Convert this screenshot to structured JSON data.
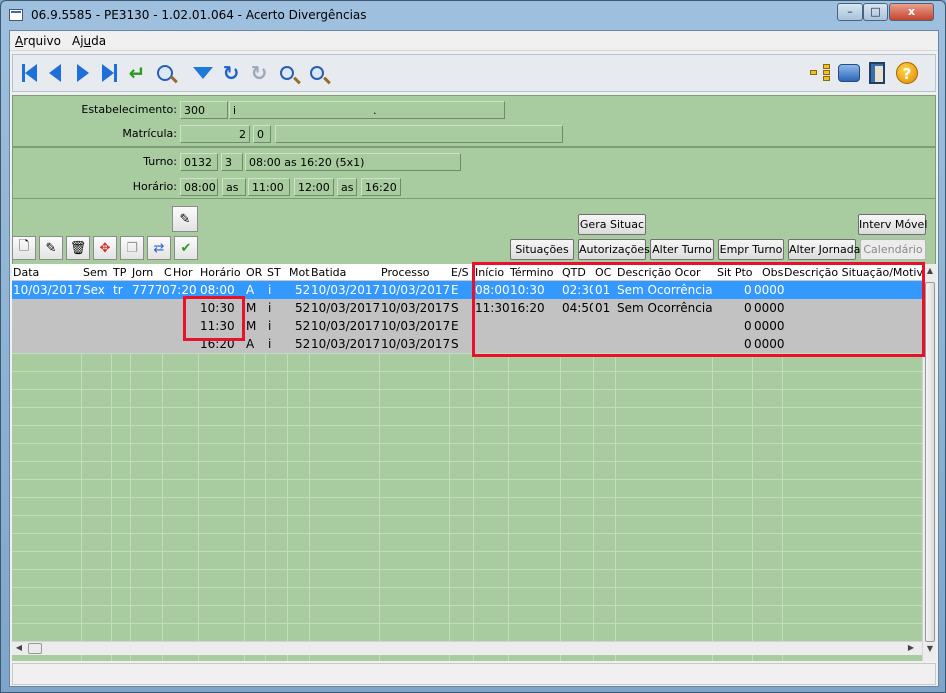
{
  "window": {
    "title": "06.9.5585 - PE3130 - 1.02.01.064 - Acerto Divergências",
    "min": "–",
    "max": "□",
    "close": "x"
  },
  "menu": [
    {
      "prefix": "",
      "accel": "A",
      "rest": "rquivo"
    },
    {
      "prefix": "Aj",
      "accel": "u",
      "rest": "da"
    }
  ],
  "toolbar_icons": [
    "first-record-icon",
    "prev-record-icon",
    "next-record-icon",
    "last-record-icon",
    "confirm-icon",
    "view-icon",
    "filter-icon",
    "refresh-icon",
    "redo-icon",
    "zoom-out-icon",
    "zoom-in-icon",
    "tree-icon",
    "print-icon",
    "exit-icon",
    "help-icon"
  ],
  "header": {
    "estabelecimento_label": "Estabelecimento:",
    "estabelecimento_code": "300",
    "estabelecimento_sub": "i",
    "estabelecimento_desc": ".",
    "matricula_label": "Matrícula:",
    "matricula_value": "2",
    "matricula_digit": "0",
    "matricula_name": ""
  },
  "schedule": {
    "turno_label": "Turno:",
    "turno_code": "0132",
    "turno_seq": "3",
    "turno_desc": "08:00 as 16:20 (5x1)",
    "horario_label": "Horário:",
    "h1": "08:00",
    "as1": "as",
    "h2": "11:00",
    "h3": "12:00",
    "as2": "as",
    "h4": "16:20"
  },
  "buttons": {
    "gera_situac": "Gera Situac",
    "interv_movel": "Interv Móvel",
    "situacoes": "Situações",
    "autorizacoes": "Autorizações",
    "alter_turno": "Alter Turno",
    "empr_turno": "Empr Turno",
    "alter_jornada": "Alter Jornada",
    "calendario": "Calendário"
  },
  "grid": {
    "columns": [
      "Data",
      "Sem",
      "TP",
      "Jorn",
      "C",
      "Hor",
      "Horário",
      "OR",
      "ST",
      "Mot",
      "Batida",
      "Processo",
      "E/S",
      "Início",
      "Término",
      "QTD",
      "OC",
      "Descrição Ocor",
      "Sit Pto",
      "Obs",
      "Descrição Situação/Motivo"
    ],
    "rows": [
      {
        "data": "10/03/2017",
        "sem": "Sex",
        "tp": "tr",
        "jorn": "7777",
        "hor": "07:20",
        "horario": "08:00",
        "or": "A",
        "st": "i",
        "mot": "52",
        "batida": "10/03/2017",
        "processo": "10/03/2017",
        "es": "E",
        "inicio": "08:00",
        "termino": "10:30",
        "qtd": "02:30",
        "oc": "01",
        "desc": "Sem Ocorrência",
        "sit": "0",
        "obs": "0000",
        "selected": true
      },
      {
        "data": "",
        "sem": "",
        "tp": "",
        "jorn": "",
        "hor": "",
        "horario": "10:30",
        "or": "M",
        "st": "i",
        "mot": "52",
        "batida": "10/03/2017",
        "processo": "10/03/2017",
        "es": "S",
        "inicio": "11:30",
        "termino": "16:20",
        "qtd": "04:50",
        "oc": "01",
        "desc": "Sem Ocorrência",
        "sit": "0",
        "obs": "0000",
        "selected": false
      },
      {
        "data": "",
        "sem": "",
        "tp": "",
        "jorn": "",
        "hor": "",
        "horario": "11:30",
        "or": "M",
        "st": "i",
        "mot": "52",
        "batida": "10/03/2017",
        "processo": "10/03/2017",
        "es": "E",
        "inicio": "",
        "termino": "",
        "qtd": "",
        "oc": "",
        "desc": "",
        "sit": "0",
        "obs": "0000",
        "selected": false
      },
      {
        "data": "",
        "sem": "",
        "tp": "",
        "jorn": "",
        "hor": "",
        "horario": "16:20",
        "or": "A",
        "st": "i",
        "mot": "52",
        "batida": "10/03/2017",
        "processo": "10/03/2017",
        "es": "S",
        "inicio": "",
        "termino": "",
        "qtd": "",
        "oc": "",
        "desc": "",
        "sit": "0",
        "obs": "0000",
        "selected": false
      }
    ]
  },
  "colors": {
    "highlight_box": "#e8102a",
    "selection": "#3399ff",
    "panel_green": "#a8cba0"
  }
}
